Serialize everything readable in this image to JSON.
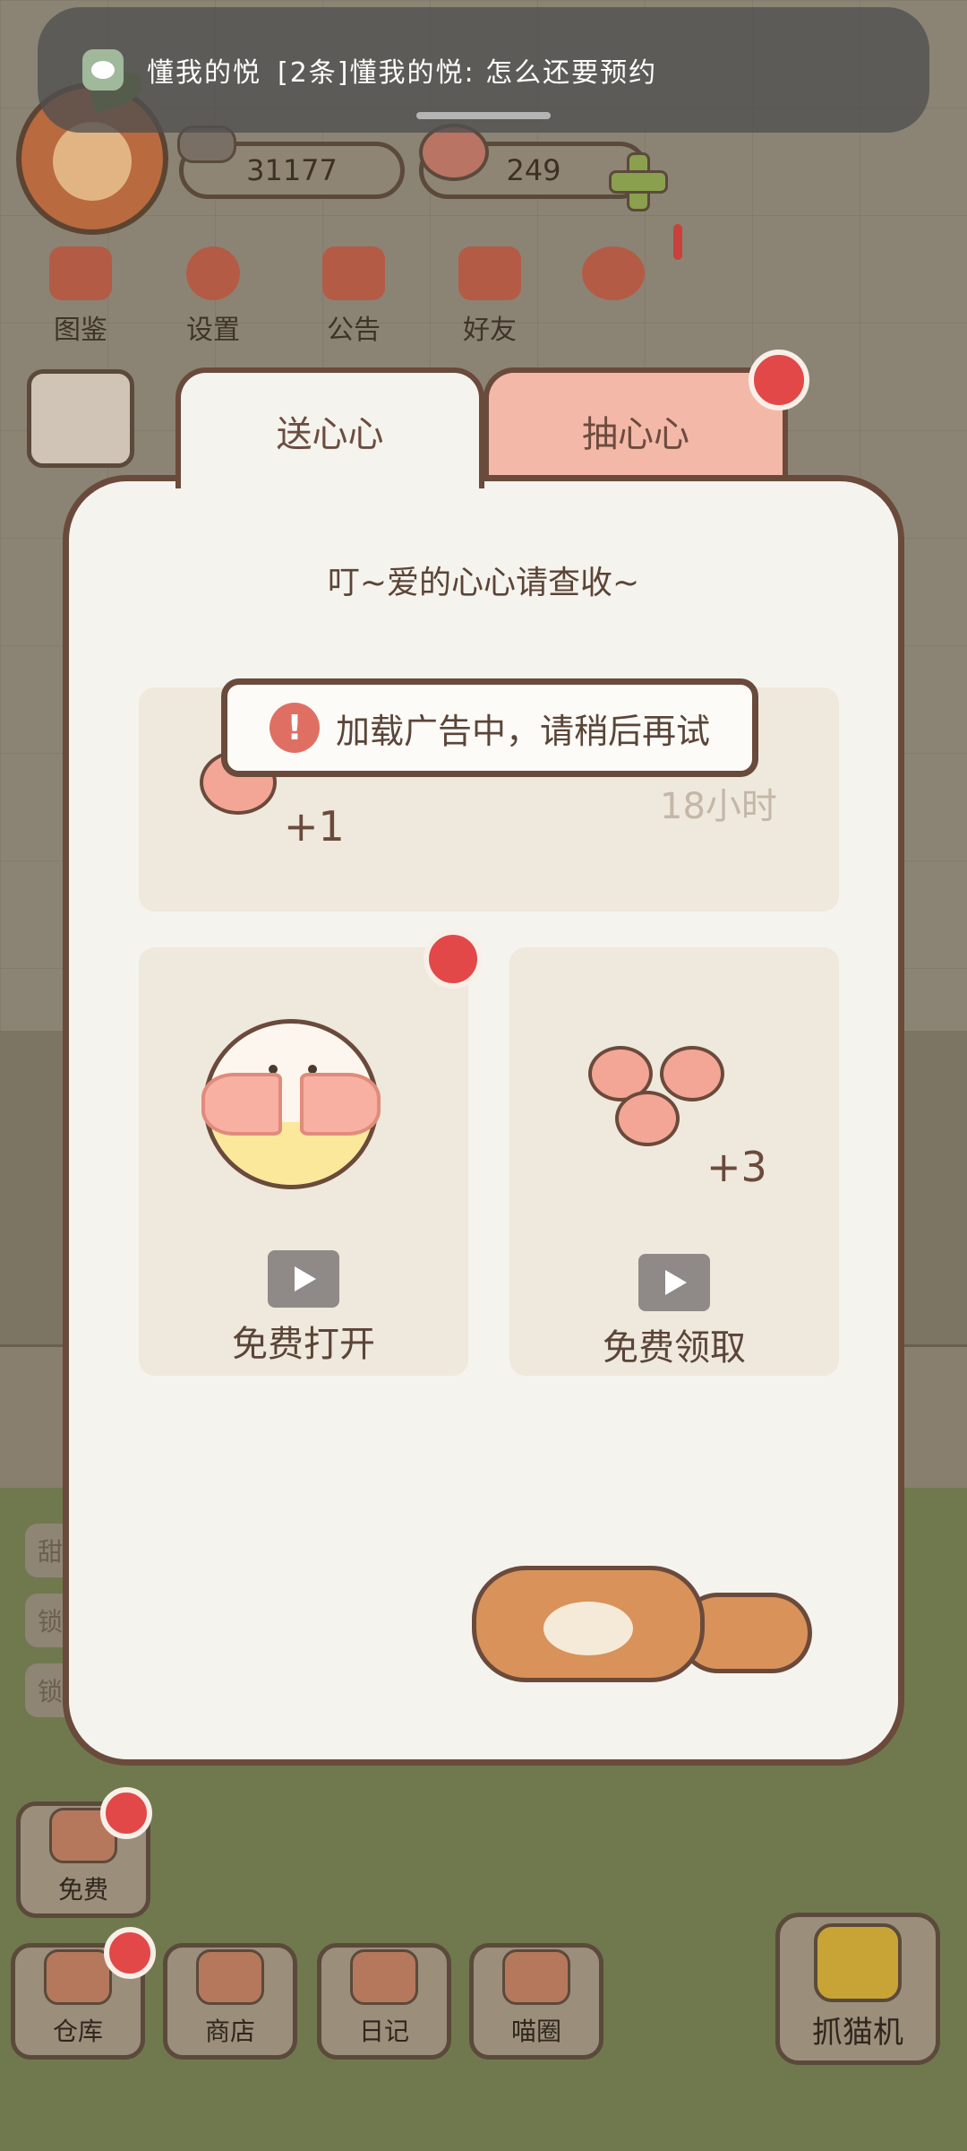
{
  "notification": {
    "sender": "懂我的悦",
    "message": "[2条]懂我的悦: 怎么还要预约"
  },
  "hud": {
    "fish_count": "31177",
    "heart_count": "249"
  },
  "top_menu": {
    "items": [
      {
        "label": "图鉴",
        "icon": "book-icon"
      },
      {
        "label": "设置",
        "icon": "gear-icon"
      },
      {
        "label": "公告",
        "icon": "gift-icon"
      },
      {
        "label": "好友",
        "icon": "friends-icon"
      },
      {
        "label": "",
        "icon": "heart-mail-icon"
      }
    ]
  },
  "modal": {
    "tabs": [
      {
        "label": "送心心",
        "active": true
      },
      {
        "label": "抽心心",
        "active": false
      }
    ],
    "title": "叮~爱的心心请查收~",
    "timed_reward": {
      "amount": "+1",
      "timer": "18小时"
    },
    "toast": "加载广告中，请稍后再试",
    "cards": [
      {
        "button_label": "免费打开",
        "icon": "gift-egg-icon"
      },
      {
        "button_label": "免费领取",
        "icon": "hearts-icon",
        "amount": "+3"
      }
    ]
  },
  "bottom_bar": {
    "free_label": "免费",
    "items": [
      {
        "label": "仓库",
        "icon": "storage-icon"
      },
      {
        "label": "商店",
        "icon": "shop-icon"
      },
      {
        "label": "日记",
        "icon": "diary-icon"
      },
      {
        "label": "喵圈",
        "icon": "cat-planet-icon"
      }
    ],
    "claw_label": "抓猫机"
  },
  "side_items": [
    "甜",
    "锁",
    "锁之"
  ],
  "colors": {
    "accent_red": "#e24848",
    "tab_inactive": "#f4b8a8",
    "modal_bg": "#f5f3ee",
    "outline_brown": "#6a4a3b"
  }
}
